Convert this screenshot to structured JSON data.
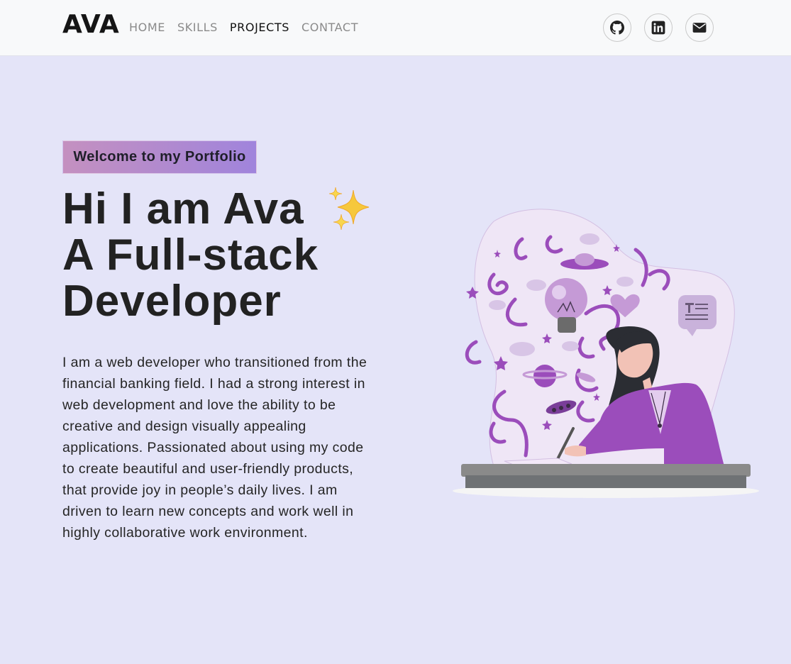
{
  "nav": {
    "brand": "AVA",
    "links": [
      {
        "label": "HOME",
        "active": false
      },
      {
        "label": "SKILLS",
        "active": false
      },
      {
        "label": "PROJECTS",
        "active": true
      },
      {
        "label": "CONTACT",
        "active": false
      }
    ],
    "social_icons": [
      "github-icon",
      "linkedin-icon",
      "envelope-icon"
    ]
  },
  "hero": {
    "tagline": "Welcome to my Portfolio",
    "headline_line1": "Hi I am Ava",
    "headline_line2": "A Full-stack",
    "headline_line3": "Developer",
    "sparkle_icon": "sparkles-icon",
    "bio": "I am a web developer who transitioned from the financial banking field. I had a strong interest in web development and love the ability to be creative and design visually appealing applications. Passionated about using my code to create beautiful and user-friendly products, that provide joy in people’s daily lives. I am driven to learn new concepts and work well in highly collaborative work environment."
  },
  "illustration": {
    "icon": "developer-illustration"
  },
  "colors": {
    "page_bg": "#e4e4f8",
    "navbar_bg": "#f8f9fa",
    "tagline_gradient_start": "#c490c0",
    "tagline_gradient_end": "#a084dc",
    "accent_purple": "#9b4dbb"
  }
}
